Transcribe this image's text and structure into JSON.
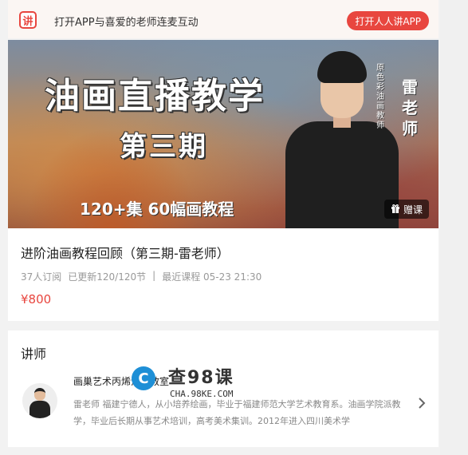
{
  "appbar": {
    "logo": "讲",
    "promo_text": "打开APP与喜爱的老师连麦互动",
    "open_button": "打开人人讲APP"
  },
  "banner": {
    "title": "油画直播教学",
    "subtitle": "第三期",
    "bottom_text": "120+集  60幅画教程",
    "vertical_caption": "原色彩油画教师",
    "teacher_name": "雷老师",
    "gift_label": "赠课",
    "gift_icon": "gift-icon"
  },
  "course": {
    "title": "进阶油画教程回顾（第三期-雷老师）",
    "subscribers": "37人订阅",
    "updated": "已更新120/120节",
    "latest": "最近课程 05-23 21:30",
    "price": "¥800"
  },
  "lecturer": {
    "heading": "讲师",
    "name": "画巢艺术丙烯油画教室",
    "bio": "雷老师 福建宁德人，从小培养绘画，毕业于福建师范大学艺术教育系。油画学院派教学，毕业后长期从事艺术培训，高考美术集训。2012年进入四川美术学"
  },
  "watermark": {
    "brand": "查98课",
    "domain": "CHA.98KE.COM"
  }
}
